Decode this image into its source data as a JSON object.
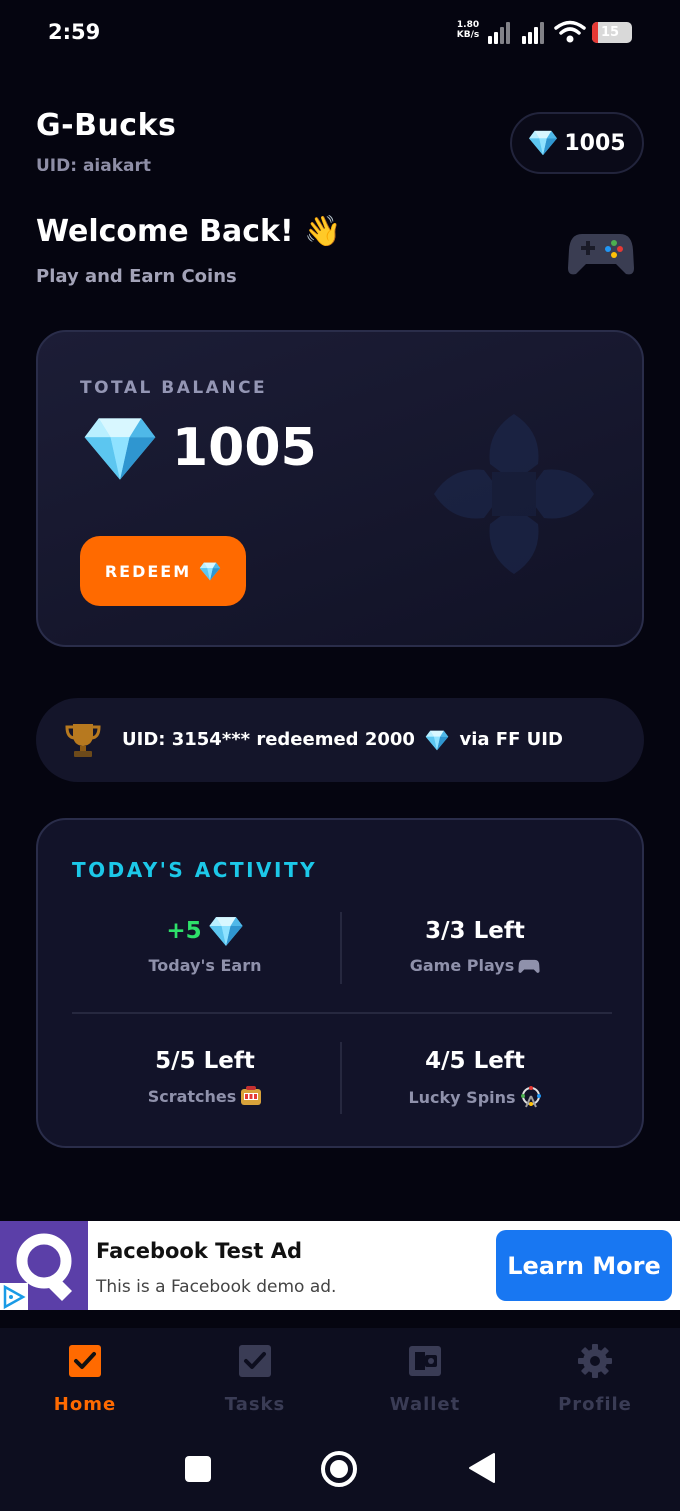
{
  "status_bar": {
    "time": "2:59",
    "net_speed_value": "1.80",
    "net_speed_unit": "KB/s",
    "battery": "15",
    "battery_level": 0.15
  },
  "header": {
    "app_title": "G-Bucks",
    "uid": "UID: aiakart",
    "balance_pill": "1005"
  },
  "welcome": {
    "title": "Welcome Back! 👋",
    "subtitle": "Play and Earn Coins"
  },
  "balance_card": {
    "label": "TOTAL BALANCE",
    "value": "1005",
    "redeem_label": "REDEEM"
  },
  "ticker": {
    "text_before": "UID: 3154*** redeemed 2000",
    "text_after": "via FF UID"
  },
  "activity": {
    "title": "TODAY'S ACTIVITY",
    "earn_value": "+5",
    "earn_label": "Today's Earn",
    "game_plays_value": "3/3 Left",
    "game_plays_label": "Game Plays",
    "scratches_value": "5/5 Left",
    "scratches_label": "Scratches",
    "spins_value": "4/5 Left",
    "spins_label": "Lucky Spins"
  },
  "ad": {
    "title": "Facebook Test Ad",
    "body": "This is a Facebook demo ad.",
    "cta": "Learn More"
  },
  "nav": {
    "items": [
      {
        "label": "Home",
        "icon": "home-check-icon"
      },
      {
        "label": "Tasks",
        "icon": "tasks-check-icon"
      },
      {
        "label": "Wallet",
        "icon": "wallet-icon"
      },
      {
        "label": "Profile",
        "icon": "gear-icon"
      }
    ],
    "active": "Home"
  },
  "colors": {
    "background": "#050510",
    "accent_orange": "#ff6a00",
    "accent_cyan": "#1cc8e8",
    "earn_green": "#2ee06a",
    "ad_cta_blue": "#1877f2"
  }
}
